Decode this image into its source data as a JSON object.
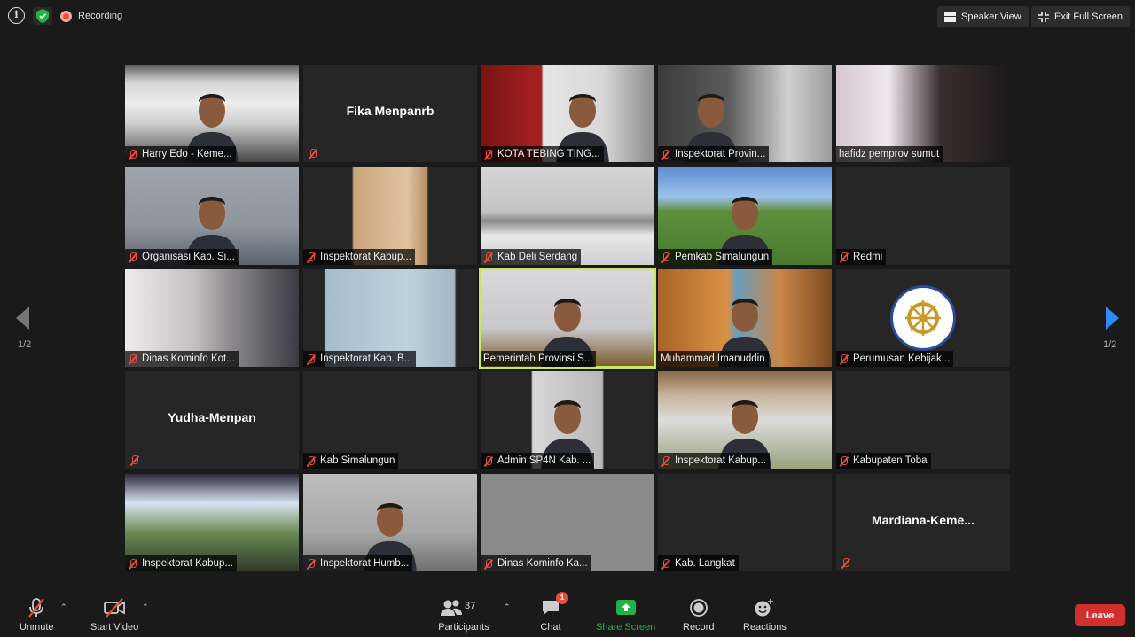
{
  "top": {
    "recording_label": "Recording",
    "speaker_view_label": "Speaker View",
    "exit_fullscreen_label": "Exit Full Screen"
  },
  "pagination": {
    "left": "1/2",
    "right": "1/2"
  },
  "tiles": [
    {
      "label": "Harry Edo - Keme...",
      "center": "",
      "scene": "office",
      "muted": true
    },
    {
      "label": "",
      "center": "Fika Menpanrb",
      "scene": "none",
      "muted": true
    },
    {
      "label": "KOTA TEBING TING...",
      "center": "",
      "scene": "red",
      "muted": true
    },
    {
      "label": "Inspektorat Provin...",
      "center": "",
      "scene": "dark",
      "muted": true
    },
    {
      "label": "hafidz pemprov sumut",
      "center": "",
      "scene": "curtain",
      "muted": false
    },
    {
      "label": "Organisasi Kab. Si...",
      "center": "",
      "scene": "grey",
      "muted": true
    },
    {
      "label": "Inspektorat Kabup...",
      "center": "",
      "scene": "wood",
      "muted": true
    },
    {
      "label": "Kab Deli Serdang",
      "center": "",
      "scene": "room",
      "muted": true
    },
    {
      "label": "Pemkab Simalungun",
      "center": "",
      "scene": "field",
      "muted": true
    },
    {
      "label": "Redmi",
      "center": "",
      "scene": "none",
      "muted": true
    },
    {
      "label": "Dinas Kominfo Kot...",
      "center": "",
      "scene": "pattern",
      "muted": true
    },
    {
      "label": "Inspektorat Kab. B...",
      "center": "",
      "scene": "wall",
      "muted": true
    },
    {
      "label": "Pemerintah Provinsi S...",
      "center": "",
      "scene": "speaker",
      "muted": false,
      "active": true
    },
    {
      "label": "Muhammad Imanuddin",
      "center": "",
      "scene": "orange",
      "muted": false
    },
    {
      "label": "Perumusan Kebijak...",
      "center": "",
      "scene": "logo",
      "muted": true
    },
    {
      "label": "",
      "center": "Yudha-Menpan",
      "scene": "none",
      "muted": true
    },
    {
      "label": "Kab Simalungun",
      "center": "",
      "scene": "none",
      "muted": true
    },
    {
      "label": "Admin SP4N Kab. ...",
      "center": "",
      "scene": "portrait",
      "muted": true
    },
    {
      "label": "Inspektorat Kabup...",
      "center": "",
      "scene": "hut",
      "muted": true
    },
    {
      "label": "Kabupaten Toba",
      "center": "",
      "scene": "none",
      "muted": true
    },
    {
      "label": "Inspektorat Kabup...",
      "center": "",
      "scene": "lights",
      "muted": true
    },
    {
      "label": "Inspektorat Humb...",
      "center": "",
      "scene": "grey2",
      "muted": true
    },
    {
      "label": "Dinas Kominfo Ka...",
      "center": "",
      "scene": "flat",
      "muted": true
    },
    {
      "label": "Kab. Langkat",
      "center": "",
      "scene": "none",
      "muted": true
    },
    {
      "label": "",
      "center": "Mardiana-Keme...",
      "scene": "none",
      "muted": true
    }
  ],
  "bottom": {
    "unmute": "Unmute",
    "start_video": "Start Video",
    "participants": "Participants",
    "participants_count": "37",
    "chat": "Chat",
    "chat_badge": "1",
    "share_screen": "Share Screen",
    "record": "Record",
    "reactions": "Reactions",
    "leave": "Leave"
  },
  "colors": {
    "accent_green": "#21b34a",
    "active_border": "#c6e85a",
    "leave_red": "#d22f2f",
    "arrow_blue": "#2d8cff"
  }
}
